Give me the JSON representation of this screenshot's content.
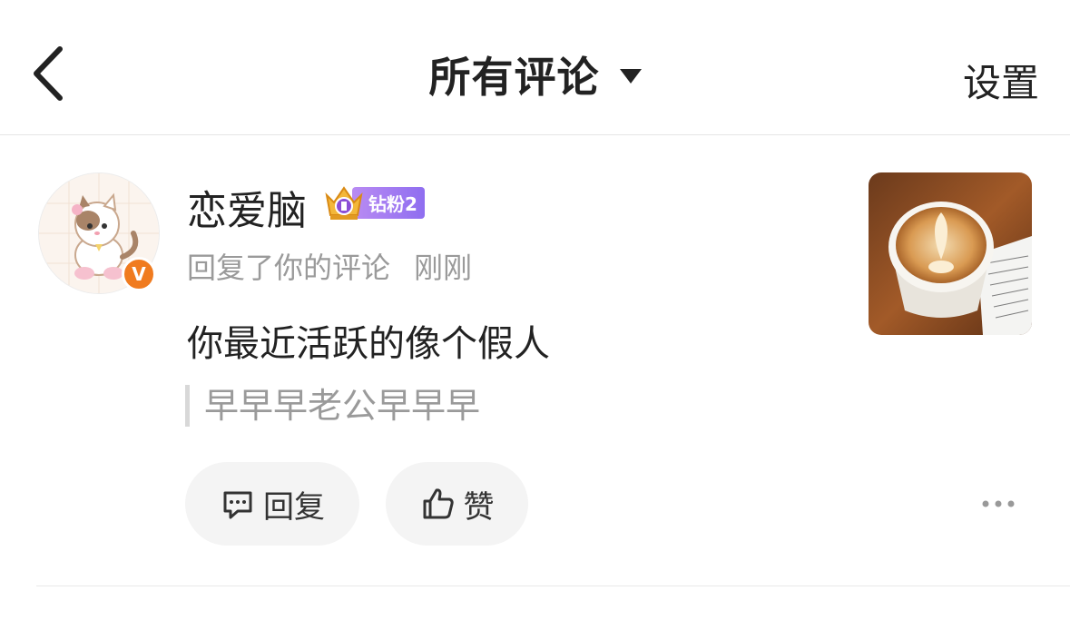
{
  "header": {
    "title": "所有评论",
    "settings_label": "设置"
  },
  "comment": {
    "username": "恋爱脑",
    "fan_badge": "钻粉2",
    "action_text": "回复了你的评论",
    "time": "刚刚",
    "content": "你最近活跃的像个假人",
    "quoted": "早早早老公早早早",
    "verified_mark": "V"
  },
  "actions": {
    "reply_label": "回复",
    "like_label": "赞"
  },
  "icons": [
    "back-icon",
    "caret-down-icon",
    "verified-icon",
    "crown-icon",
    "comment-icon",
    "thumbs-up-icon",
    "more-icon"
  ],
  "colors": {
    "accent_orange": "#f07b1f",
    "badge_purple": "#9a74f1",
    "muted_text": "#9a9a9a"
  }
}
